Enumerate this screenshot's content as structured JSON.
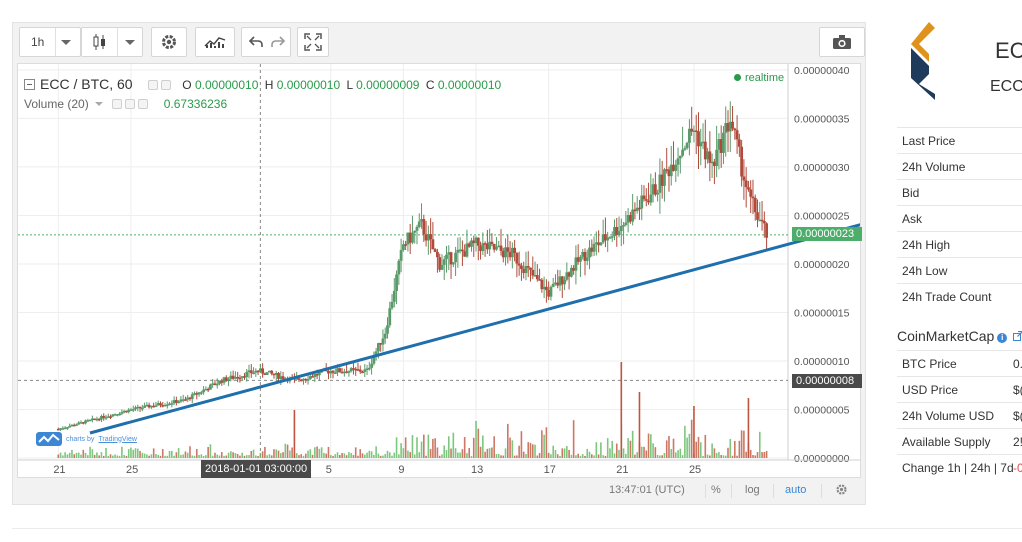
{
  "toolbar": {
    "interval": "1h",
    "icons": [
      "chevron-down-icon",
      "candlestick-icon",
      "gear-icon",
      "indicators-icon",
      "undo-icon",
      "redo-icon",
      "fullscreen-icon",
      "camera-icon"
    ]
  },
  "legend": {
    "symbol": "ECC / BTC, 60",
    "o_label": "O",
    "o_value": "0.00000010",
    "h_label": "H",
    "h_value": "0.00000010",
    "l_label": "L",
    "l_value": "0.00000009",
    "c_label": "C",
    "c_value": "0.00000010",
    "volume_label": "Volume (20)",
    "volume_value": "0.67336236",
    "realtime": "realtime"
  },
  "price_axis": {
    "labels": [
      "0.00000040",
      "0.00000035",
      "0.00000030",
      "0.00000025",
      "0.00000020",
      "0.00000015",
      "0.00000010",
      "0.00000005",
      "0.00000000"
    ],
    "current_price_tag": "0.00000023",
    "crosshair_price_tag": "0.00000008"
  },
  "time_axis": {
    "labels": [
      "21",
      "25",
      "5",
      "9",
      "13",
      "17",
      "21",
      "25"
    ],
    "crosshair_date": "2018-01-01 03:00:00"
  },
  "statusbar": {
    "clock": "13:47:01 (UTC)",
    "percent": "%",
    "log": "log",
    "auto": "auto"
  },
  "branding": {
    "prefix": "charts by",
    "link": "TradingView"
  },
  "colors": {
    "up": "#5a9a6a",
    "down": "#b04a3a",
    "trendline": "#1f6fad",
    "accent": "#2a9a4a",
    "link": "#3b87d6"
  },
  "right_panel": {
    "title": "EC",
    "subtitle": "ECC",
    "market_rows": [
      {
        "label": "Last Price",
        "value": ""
      },
      {
        "label": "24h Volume",
        "value": ""
      },
      {
        "label": "Bid",
        "value": ""
      },
      {
        "label": "Ask",
        "value": ""
      },
      {
        "label": "24h High",
        "value": ""
      },
      {
        "label": "24h Low",
        "value": ""
      },
      {
        "label": "24h Trade Count",
        "value": ""
      }
    ],
    "cmc_heading": "CoinMarketCap",
    "cmc_rows": [
      {
        "label": "BTC Price",
        "value": "0."
      },
      {
        "label": "USD Price",
        "value": "$("
      },
      {
        "label": "24h Volume USD",
        "value": "$("
      },
      {
        "label": "Available Supply",
        "value": "2!"
      },
      {
        "label": "Change 1h | 24h | 7d",
        "value": "-0",
        "negative": true
      }
    ]
  },
  "chart_data": {
    "type": "candlestick",
    "symbol": "ECC / BTC",
    "interval_minutes": 60,
    "y_unit": "BTC",
    "ylim": [
      0,
      4e-07
    ],
    "x_ticks": [
      "Dec 21",
      "Dec 25",
      "2018-01-01",
      "Jan 5",
      "Jan 9",
      "Jan 13",
      "Jan 17",
      "Jan 21",
      "Jan 25"
    ],
    "close_series": [
      {
        "date": "2017-12-21",
        "close": 3e-08
      },
      {
        "date": "2017-12-23",
        "close": 4e-08
      },
      {
        "date": "2017-12-25",
        "close": 5e-08
      },
      {
        "date": "2017-12-28",
        "close": 6e-08
      },
      {
        "date": "2017-12-30",
        "close": 8e-08
      },
      {
        "date": "2018-01-01",
        "close": 9e-08
      },
      {
        "date": "2018-01-03",
        "close": 8e-08
      },
      {
        "date": "2018-01-05",
        "close": 9e-08
      },
      {
        "date": "2018-01-07",
        "close": 9e-08
      },
      {
        "date": "2018-01-08",
        "close": 1.3e-07
      },
      {
        "date": "2018-01-09",
        "close": 2.2e-07
      },
      {
        "date": "2018-01-10",
        "close": 2.4e-07
      },
      {
        "date": "2018-01-11",
        "close": 2e-07
      },
      {
        "date": "2018-01-13",
        "close": 2.2e-07
      },
      {
        "date": "2018-01-15",
        "close": 2.1e-07
      },
      {
        "date": "2018-01-17",
        "close": 1.7e-07
      },
      {
        "date": "2018-01-19",
        "close": 2.1e-07
      },
      {
        "date": "2018-01-21",
        "close": 2.4e-07
      },
      {
        "date": "2018-01-23",
        "close": 2.8e-07
      },
      {
        "date": "2018-01-25",
        "close": 3.4e-07
      },
      {
        "date": "2018-01-26",
        "close": 3e-07
      },
      {
        "date": "2018-01-27",
        "close": 3.5e-07
      },
      {
        "date": "2018-01-28",
        "close": 2.7e-07
      },
      {
        "date": "2018-01-29",
        "close": 2.3e-07
      }
    ],
    "volume_note": "Volume (20)",
    "grid": true,
    "log_scale": false
  }
}
